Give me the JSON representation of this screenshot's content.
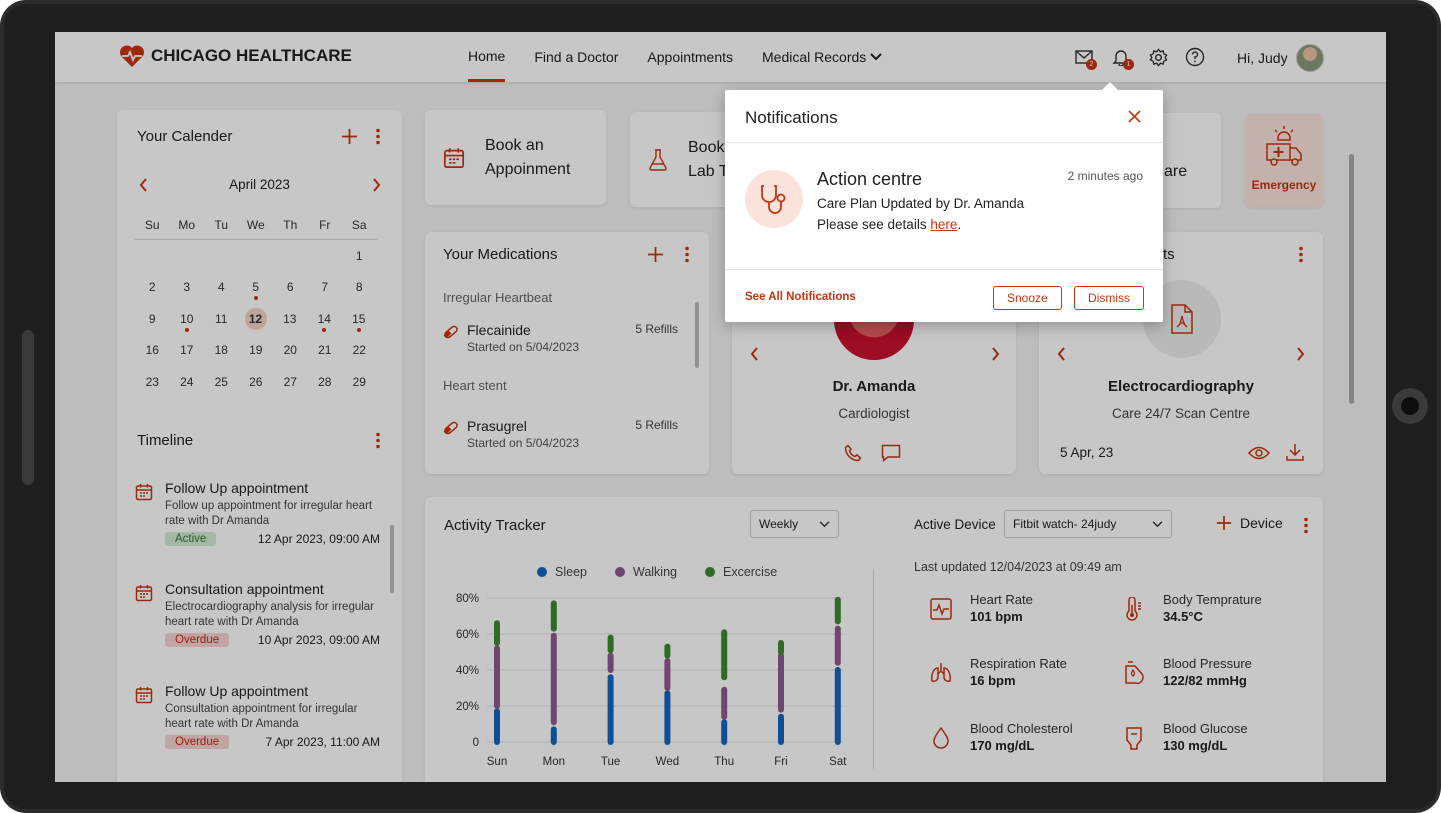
{
  "header": {
    "brand": "CHICAGO HEALTHCARE",
    "nav": [
      "Home",
      "Find a Doctor",
      "Appointments",
      "Medical Records"
    ],
    "mail_badge": "2",
    "bell_badge": "1",
    "greeting": "Hi, Judy"
  },
  "calendar": {
    "title": "Your Calender",
    "month": "April 2023",
    "weekdays": [
      "Su",
      "Mo",
      "Tu",
      "We",
      "Th",
      "Fr",
      "Sa"
    ],
    "weeks": [
      [
        "",
        "",
        "",
        "",
        "",
        "",
        "1"
      ],
      [
        "2",
        "3",
        "4",
        "5",
        "6",
        "7",
        "8"
      ],
      [
        "9",
        "10",
        "11",
        "12",
        "13",
        "14",
        "15"
      ],
      [
        "16",
        "17",
        "18",
        "19",
        "20",
        "21",
        "22"
      ],
      [
        "23",
        "24",
        "25",
        "26",
        "27",
        "28",
        "29"
      ]
    ]
  },
  "timeline": {
    "title": "Timeline",
    "items": [
      {
        "title": "Follow Up appointment",
        "desc": "Follow up appointment for irregular heart rate with Dr Amanda",
        "status": "Active",
        "date": "12 Apr 2023, 09:00 AM"
      },
      {
        "title": "Consultation appointment",
        "desc": "Electrocardiography analysis for irregular heart rate with Dr Amanda",
        "status": "Overdue",
        "date": "10 Apr 2023, 09:00 AM"
      },
      {
        "title": "Follow Up appointment",
        "desc": "Consultation appointment for irregular heart rate with Dr Amanda",
        "status": "Overdue",
        "date": "7 Apr 2023, 11:00 AM"
      }
    ]
  },
  "quick": {
    "book_appointment": "Book an Appoinment",
    "book_lab": "Book Lab T",
    "care_partial": "are",
    "emergency": "Emergency"
  },
  "medications": {
    "title": "Your Medications",
    "groups": [
      {
        "name": "Irregular Heartbeat",
        "drug": "Flecainide",
        "started": "Started on 5/04/2023",
        "refills": "5 Refills"
      },
      {
        "name": "Heart stent",
        "drug": "Prasugrel",
        "started": "Started on 5/04/2023",
        "refills": "5 Refills"
      }
    ]
  },
  "doctor": {
    "name": "Dr. Amanda",
    "role": "Cardiologist"
  },
  "reports": {
    "title_partial": "rts",
    "name": "Electrocardiography",
    "place": "Care 24/7 Scan Centre",
    "date": "5 Apr, 23"
  },
  "activity": {
    "title": "Activity Tracker",
    "period": "Weekly",
    "legend": [
      "Sleep",
      "Walking",
      "Excercise"
    ]
  },
  "device": {
    "label": "Active Device",
    "selected": "Fitbit watch- 24judy",
    "add": "Device",
    "updated": "Last updated 12/04/2023 at 09:49 am",
    "vitals": [
      {
        "label": "Heart Rate",
        "value": "101 bpm"
      },
      {
        "label": "Body Temprature",
        "value": "34.5°C"
      },
      {
        "label": "Respiration Rate",
        "value": "16 bpm"
      },
      {
        "label": "Blood Pressure",
        "value": "122/82 mmHg"
      },
      {
        "label": "Blood Cholesterol",
        "value": "170 mg/dL"
      },
      {
        "label": "Blood Glucose",
        "value": "130 mg/dL"
      }
    ]
  },
  "notification": {
    "title": "Notifications",
    "heading": "Action centre",
    "time": "2 minutes ago",
    "line1": "Care Plan Updated by Dr. Amanda",
    "line2": "Please see details ",
    "link": "here",
    "see_all": "See All Notifications",
    "snooze": "Snooze",
    "dismiss": "Dismiss"
  },
  "colors": {
    "accent": "#c8350f",
    "sleep": "#1565c0",
    "walking": "#8e5a8e",
    "exercise": "#3b8a2e"
  },
  "chart_data": {
    "type": "bar",
    "categories": [
      "Sun",
      "Mon",
      "Tue",
      "Wed",
      "Thu",
      "Fri",
      "Sat"
    ],
    "ylim": [
      0,
      80
    ],
    "yticks": [
      "80%",
      "60%",
      "40%",
      "20%",
      "0"
    ],
    "series": [
      {
        "name": "Sleep",
        "ranges": [
          [
            0,
            17
          ],
          [
            0,
            7
          ],
          [
            0,
            36
          ],
          [
            0,
            27
          ],
          [
            0,
            11
          ],
          [
            0,
            14
          ],
          [
            0,
            40
          ]
        ]
      },
      {
        "name": "Walking",
        "ranges": [
          [
            20,
            52
          ],
          [
            11,
            59
          ],
          [
            40,
            48
          ],
          [
            30,
            45
          ],
          [
            14,
            29
          ],
          [
            18,
            48
          ],
          [
            44,
            63
          ]
        ]
      },
      {
        "name": "Excercise",
        "ranges": [
          [
            55,
            66
          ],
          [
            63,
            77
          ],
          [
            51,
            58
          ],
          [
            48,
            53
          ],
          [
            36,
            61
          ],
          [
            50,
            55
          ],
          [
            67,
            79
          ]
        ]
      }
    ]
  }
}
